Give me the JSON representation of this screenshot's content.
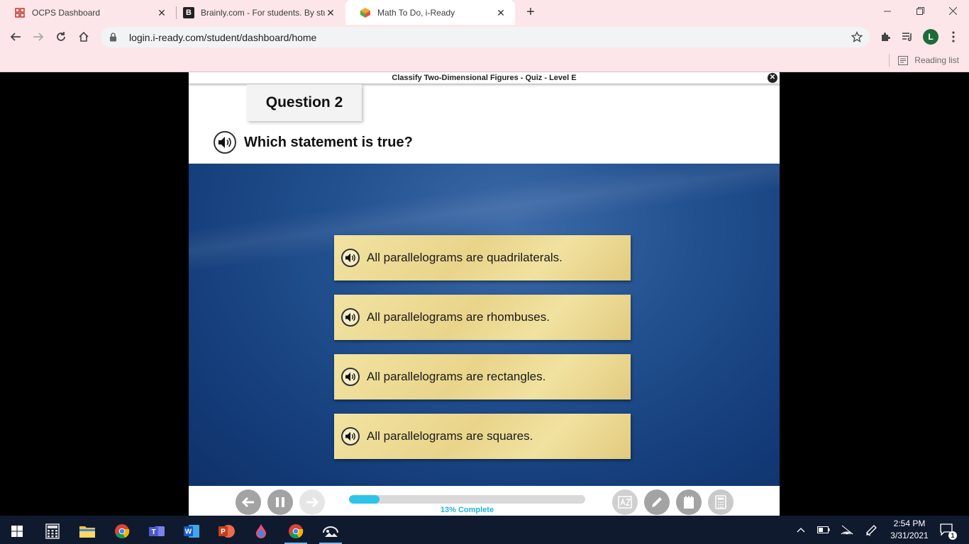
{
  "browser": {
    "tabs": [
      {
        "title": "OCPS Dashboard",
        "active": false
      },
      {
        "title": "Brainly.com - For students. By stu",
        "active": false
      },
      {
        "title": "Math To Do, i-Ready",
        "active": true
      }
    ],
    "url": "login.i-ready.com/student/dashboard/home",
    "profile_initial": "L",
    "reading_list_label": "Reading list"
  },
  "quiz": {
    "title": "Classify Two-Dimensional Figures - Quiz - Level E",
    "close_symbol": "✕",
    "question_label": "Question 2",
    "prompt": "Which statement is true?",
    "answers": [
      "All parallelograms are quadrilaterals.",
      "All parallelograms are rhombuses.",
      "All parallelograms are rectangles.",
      "All parallelograms are squares."
    ],
    "progress": {
      "percent": 13,
      "label": "13% Complete"
    }
  },
  "taskbar": {
    "time": "2:54 PM",
    "date": "3/31/2021",
    "notifications": "1"
  },
  "colors": {
    "chrome_bg": "#fde6e9",
    "stage_blue": "#22508f",
    "answer_paper": "#e9d48a",
    "progress": "#2ec4e8"
  }
}
